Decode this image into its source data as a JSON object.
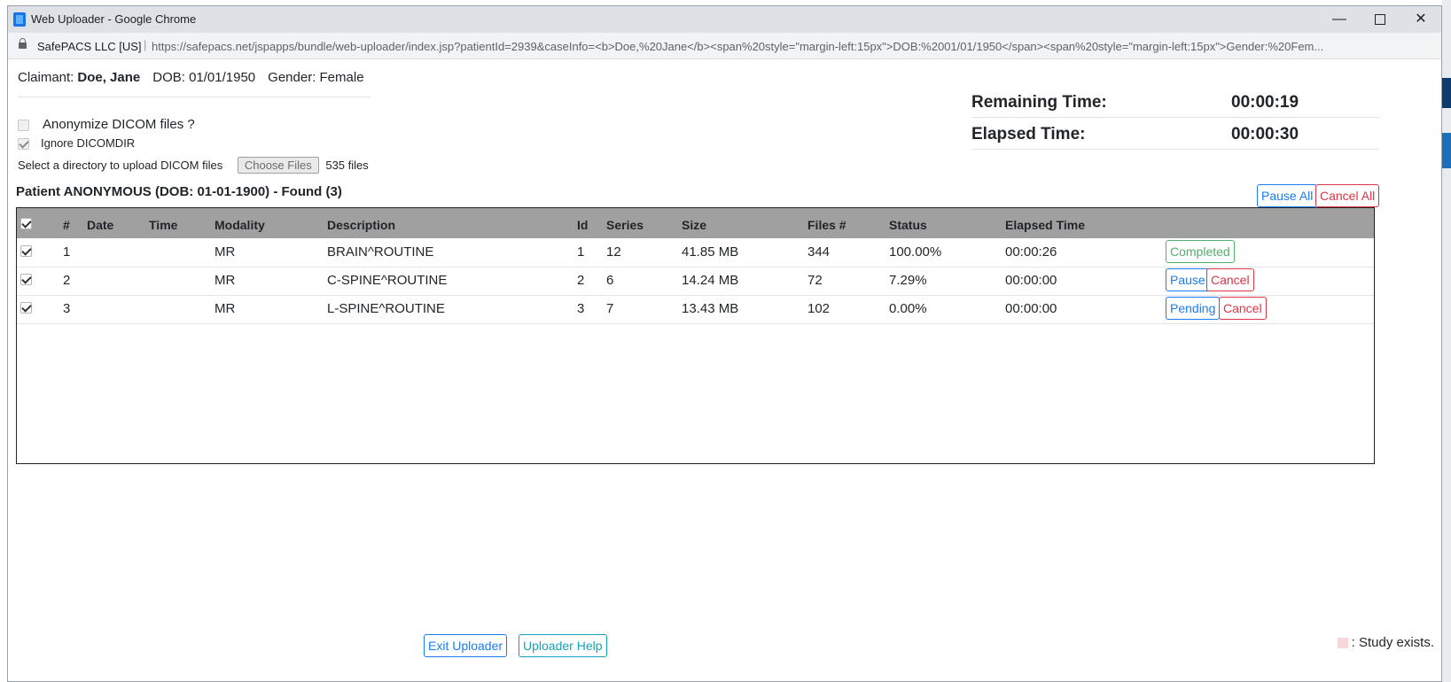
{
  "window": {
    "title": "Web Uploader - Google Chrome",
    "org": "SafePACS LLC [US]",
    "url": "https://safepacs.net/jspapps/bundle/web-uploader/index.jsp?patientId=2939&caseInfo=<b>Doe,%20Jane</b><span%20style=\"margin-left:15px\">DOB:%2001/01/1950</span><span%20style=\"margin-left:15px\">Gender:%20Fem..."
  },
  "claimant": {
    "claimant_label": "Claimant:",
    "claimant_name": "Doe, Jane",
    "dob": "DOB: 01/01/1950",
    "gender": "Gender: Female"
  },
  "options": {
    "anonymize_label": "Anonymize DICOM files ?",
    "anonymize_checked": false,
    "ignore_label": "Ignore DICOMDIR",
    "ignore_checked": true,
    "select_dir_label": "Select a directory to upload DICOM files",
    "choose_files_label": "Choose Files",
    "file_count": "535 files"
  },
  "timers": {
    "remaining_label": "Remaining Time:",
    "remaining_value": "00:00:19",
    "elapsed_label": "Elapsed Time:",
    "elapsed_value": "00:00:30"
  },
  "patient": {
    "title": "Patient ANONYMOUS (DOB: 01-01-1900) - Found (3)",
    "pause_all_label": "Pause All",
    "cancel_all_label": "Cancel All"
  },
  "table": {
    "headers": [
      "#",
      "Date",
      "Time",
      "Modality",
      "Description",
      "Id",
      "Series",
      "Size",
      "Files #",
      "Status",
      "Elapsed Time"
    ],
    "rows": [
      {
        "num": "1",
        "date": "",
        "time": "",
        "modality": "MR",
        "description": "BRAIN^ROUTINE",
        "id": "1",
        "series": "12",
        "size": "41.85 MB",
        "files": "344",
        "status": "100.00%",
        "elapsed": "00:00:26",
        "action1": "Completed",
        "action2": ""
      },
      {
        "num": "2",
        "date": "",
        "time": "",
        "modality": "MR",
        "description": "C-SPINE^ROUTINE",
        "id": "2",
        "series": "6",
        "size": "14.24 MB",
        "files": "72",
        "status": "7.29%",
        "elapsed": "00:00:00",
        "action1": "Pause",
        "action2": "Cancel"
      },
      {
        "num": "3",
        "date": "",
        "time": "",
        "modality": "MR",
        "description": "L-SPINE^ROUTINE",
        "id": "3",
        "series": "7",
        "size": "13.43 MB",
        "files": "102",
        "status": "0.00%",
        "elapsed": "00:00:00",
        "action1": "Pending",
        "action2": "Cancel"
      }
    ]
  },
  "footer": {
    "exit_label": "Exit Uploader",
    "help_label": "Uploader Help",
    "legend_label": ": Study exists."
  },
  "colors": {
    "primary": "#1a7cf0",
    "danger": "#dc3545",
    "success": "#52b26a",
    "info": "#17a2b8",
    "table_header": "#a0a0a0",
    "study_exists": "#f8d7da"
  }
}
